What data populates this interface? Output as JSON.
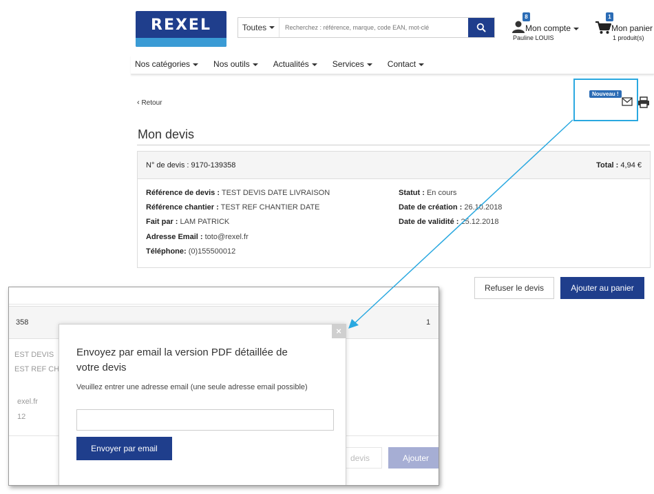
{
  "header": {
    "logo_text": "Rexel",
    "search": {
      "scope_label": "Toutes",
      "placeholder": "Recherchez : référence, marque, code EAN, mot-clé"
    },
    "account": {
      "badge": "8",
      "label": "Mon compte",
      "user_name": "Pauline LOUIS"
    },
    "cart": {
      "badge": "1",
      "label": "Mon panier",
      "count_text": "1 produit(s)"
    }
  },
  "nav": {
    "items": [
      {
        "label": "Nos catégories"
      },
      {
        "label": "Nos outils"
      },
      {
        "label": "Actualités"
      },
      {
        "label": "Services"
      },
      {
        "label": "Contact"
      }
    ]
  },
  "page": {
    "back_label": "Retour",
    "title": "Mon devis",
    "new_badge": "Nouveau !",
    "quote": {
      "number_label": "N° de devis :",
      "number_value": "9170-139358",
      "total_label": "Total :",
      "total_value": "4,94 €",
      "left_fields": [
        {
          "key": "Référence de devis :",
          "value": "TEST DEVIS DATE LIVRAISON"
        },
        {
          "key": "Référence chantier :",
          "value": "TEST REF CHANTIER DATE"
        },
        {
          "key": "Fait par :",
          "value": "LAM PATRICK"
        },
        {
          "key": "Adresse Email :",
          "value": "toto@rexel.fr"
        },
        {
          "key": "Téléphone:",
          "value": "(0)155500012"
        }
      ],
      "right_fields": [
        {
          "key": "Statut :",
          "value": "En cours"
        },
        {
          "key": "Date de création :",
          "value": "26.10.2018"
        },
        {
          "key": "Date de validité :",
          "value": "25.12.2018"
        }
      ]
    },
    "actions": {
      "refuse_label": "Refuser le devis",
      "add_label": "Ajouter au panier"
    }
  },
  "inset": {
    "bg_fragments": {
      "number": "358",
      "total": "1",
      "ref1": "EST DEVIS",
      "ref2": "EST REF CH",
      "email": "exel.fr",
      "phone": "12",
      "refuse": "devis",
      "add": "Ajouter"
    },
    "modal": {
      "title": "Envoyez par email la version PDF détaillée de votre devis",
      "hint": "Veuillez entrer une adresse email (une seule adresse email possible)",
      "email_value": "",
      "send_label": "Envoyer par email",
      "close_symbol": "×"
    }
  },
  "colors": {
    "brand_blue": "#1f3e8c",
    "accent_blue": "#29a8e0",
    "badge_blue": "#2b6cb5"
  }
}
